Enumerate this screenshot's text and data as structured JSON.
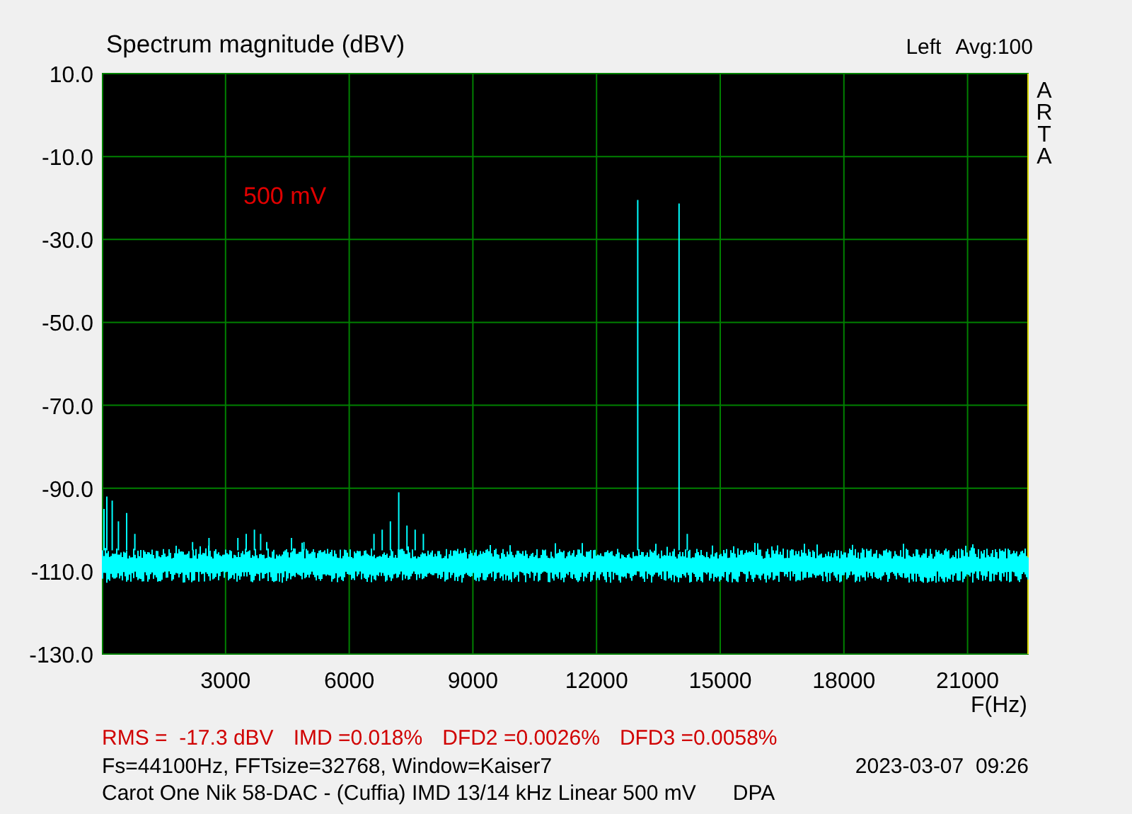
{
  "header": {
    "title": "Spectrum magnitude (dBV)",
    "channel": "Left",
    "average": "Avg:100"
  },
  "brand_letters": [
    "A",
    "R",
    "T",
    "A"
  ],
  "plot": {
    "annotation": "500 mV",
    "x_axis_label": "F(Hz)",
    "y_ticks": [
      "10.0",
      "-10.0",
      "-30.0",
      "-50.0",
      "-70.0",
      "-90.0",
      "-110.0",
      "-130.0"
    ],
    "x_ticks": [
      "3000",
      "6000",
      "9000",
      "12000",
      "15000",
      "18000",
      "21000"
    ]
  },
  "measurements": [
    "RMS =  -17.3 dBV",
    "IMD =0.018%",
    "DFD2 =0.0026%",
    "DFD3 =0.0058%"
  ],
  "settings": "Fs=44100Hz, FFTsize=32768, Window=Kaiser7",
  "timestamp": "2023-03-07  09:26",
  "description": "Carot One Nik 58-DAC - (Cuffia) IMD 13/14 kHz Linear 500 mV",
  "mode": "DPA"
}
